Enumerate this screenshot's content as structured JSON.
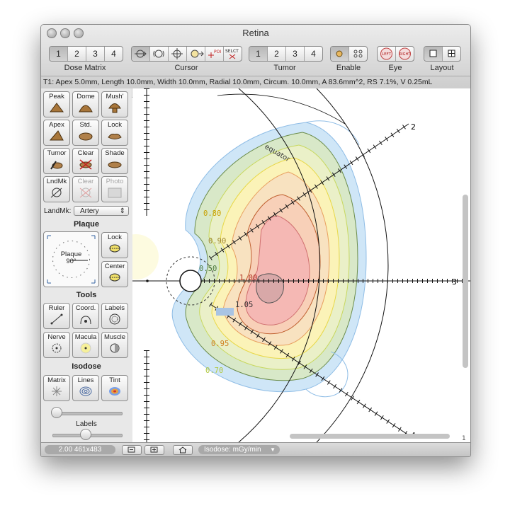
{
  "window": {
    "title": "Retina"
  },
  "toolbar": {
    "dose_matrix": {
      "label": "Dose Matrix",
      "items": [
        "1",
        "2",
        "3",
        "4"
      ]
    },
    "cursor": {
      "label": "Cursor"
    },
    "tumor": {
      "label": "Tumor",
      "items": [
        "1",
        "2",
        "3",
        "4"
      ]
    },
    "enable": {
      "label": "Enable"
    },
    "eye": {
      "label": "Eye",
      "left": "LEFT",
      "right": "RIGHT"
    },
    "layout": {
      "label": "Layout"
    },
    "poi_label": "POI",
    "select_label": "SELCT"
  },
  "info": "T1: Apex 5.0mm, Length 10.0mm, Width 10.0mm, Radial 10.0mm, Circum. 10.0mm, A 83.6mm^2, RS 7.1%, V 0.25mL",
  "sidebar": {
    "row1": [
      "Peak",
      "Dome",
      "Mush'"
    ],
    "row2": [
      "Apex",
      "Std.",
      "Lock"
    ],
    "row3": [
      "Tumor",
      "Clear",
      "Shade"
    ],
    "row4": [
      "LndMk",
      "Clear",
      "Photo"
    ],
    "landmark_label": "LandMk:",
    "landmark_value": "Artery",
    "plaque_heading": "Plaque",
    "plaque_dial": {
      "label": "Plaque",
      "angle": "90°"
    },
    "plaque_buttons": [
      "Lock",
      "Center"
    ],
    "tools_heading": "Tools",
    "tools_row1": [
      "Ruler",
      "Coord.",
      "Labels"
    ],
    "tools_row2": [
      "Nerve",
      "Macula",
      "Muscle"
    ],
    "isodose_heading": "Isodose",
    "isodose_row": [
      "Matrix",
      "Lines",
      "Tint"
    ],
    "slider_label": "Labels"
  },
  "canvas": {
    "clock_labels": [
      "2",
      "3",
      "4"
    ],
    "equator_label": "equator",
    "isodose_labels": [
      "0.80",
      "0.90",
      "0.50",
      "1.00",
      "1.05",
      "0.95",
      "0.70"
    ],
    "scroll_counter": "1"
  },
  "status": {
    "zoom": "2.00 461x483",
    "isodose_unit": "Isodose: mGy/min"
  },
  "colors": {
    "tint_outer": "#cfe6f7",
    "tint_green": "#d8e8c8",
    "tint_yellow": "#fbf3b8",
    "tint_orange": "#f8d6b0",
    "tint_red": "#f5b8b4"
  }
}
